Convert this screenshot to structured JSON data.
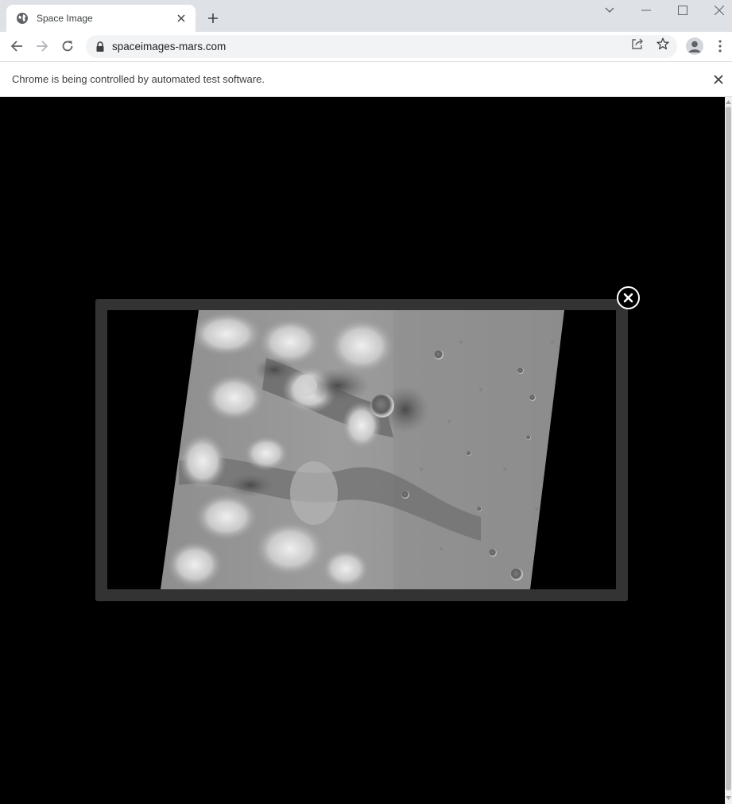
{
  "browser": {
    "tab": {
      "title": "Space Image",
      "favicon": "globe-icon",
      "close_icon": "close-icon"
    },
    "new_tab_icon": "plus-icon",
    "window_controls": [
      "chevron-down-icon",
      "minimize-icon",
      "maximize-icon",
      "close-icon"
    ],
    "address": "spaceimages-mars.com",
    "toolbar_icons": [
      "back-icon",
      "forward-icon",
      "reload-icon",
      "lock-icon",
      "share-icon",
      "star-icon",
      "profile-icon",
      "menu-icon"
    ],
    "infobar": {
      "message": "Chrome is being controlled by automated test software."
    }
  },
  "page": {
    "background": "#000000",
    "lightbox": {
      "frame_color": "#333333",
      "image_subject": "grayscale orbital image of martian surface with craters and ridges",
      "close_icon": "close-circle-icon"
    }
  }
}
